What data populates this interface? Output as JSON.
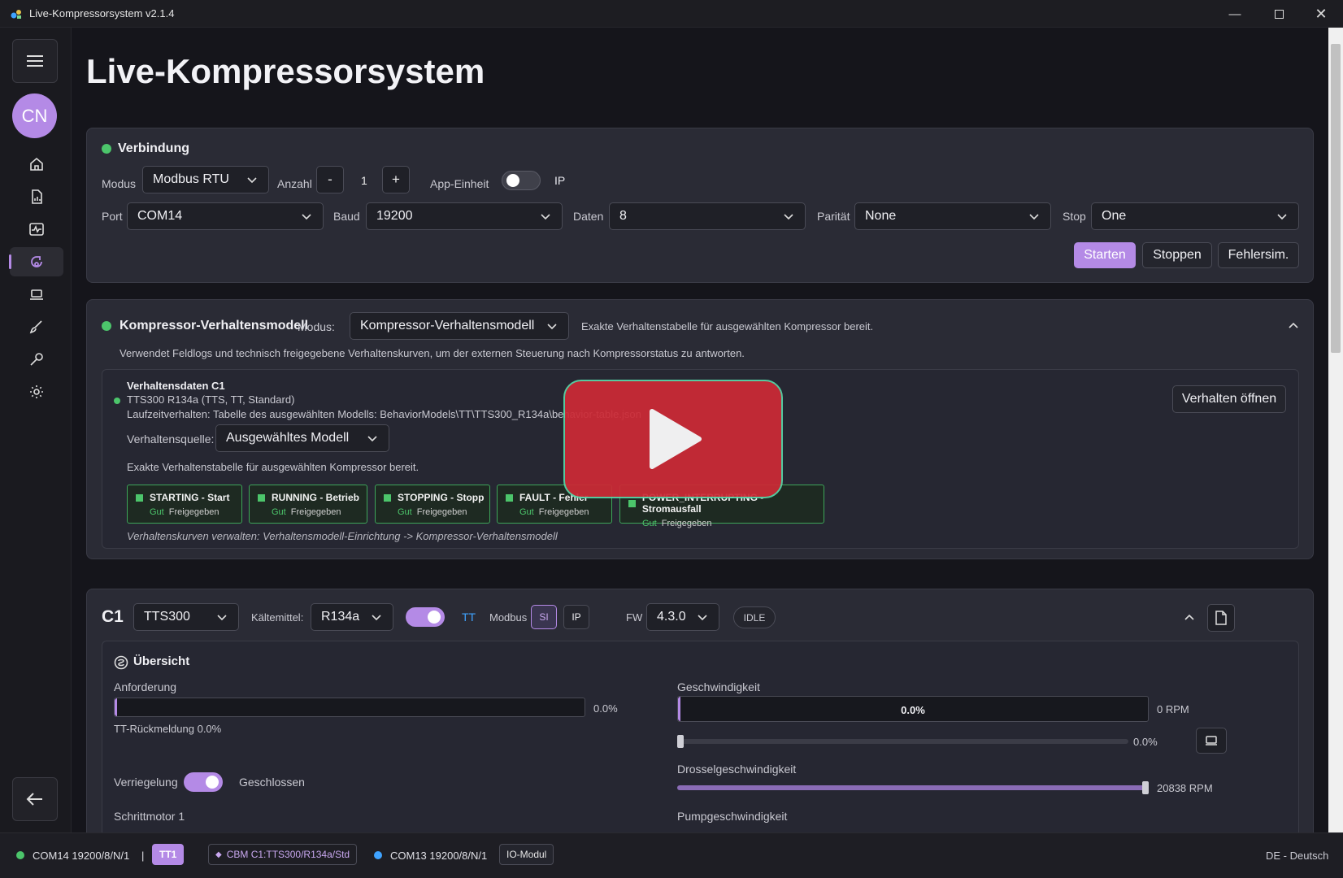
{
  "window": {
    "title": "Live-Kompressorsystem v2.1.4"
  },
  "page": {
    "title": "Live-Kompressorsystem"
  },
  "sidebar": {
    "avatar_initials": "CN"
  },
  "connection": {
    "heading": "Verbindung",
    "mode_label": "Modus",
    "mode_value": "Modbus RTU",
    "count_label": "Anzahl",
    "minus": "-",
    "count_value": "1",
    "plus": "+",
    "app_unit_label": "App-Einheit",
    "ip_label": "IP",
    "port_label": "Port",
    "port_value": "COM14",
    "baud_label": "Baud",
    "baud_value": "19200",
    "data_label": "Daten",
    "data_value": "8",
    "parity_label": "Parität",
    "parity_value": "None",
    "stop_label": "Stop",
    "stop_value": "One",
    "start_btn": "Starten",
    "stop_btn": "Stoppen",
    "faultsim_btn": "Fehlersim."
  },
  "behavior": {
    "heading": "Kompressor-Verhaltensmodell",
    "mode_label": "Modus:",
    "mode_value": "Kompressor-Verhaltensmodell",
    "status_text": "Exakte Verhaltenstabelle für ausgewählten Kompressor bereit.",
    "description": "Verwendet Feldlogs und technisch freigegebene Verhaltenskurven, um der externen Steuerung nach Kompressorstatus zu antworten.",
    "data_title": "Verhaltensdaten C1",
    "model_line": "TTS300 R134a (TTS, TT, Standard)",
    "runtime_line": "Laufzeitverhalten: Tabelle des ausgewählten Modells: BehaviorModels\\TT\\TTS300_R134a\\behavior-table.json",
    "open_btn": "Verhalten öffnen",
    "source_label": "Verhaltensquelle:",
    "source_value": "Ausgewähltes Modell",
    "ready_text": "Exakte Verhaltenstabelle für ausgewählten Kompressor bereit.",
    "states": [
      {
        "title": "STARTING - Start",
        "quality": "Gut",
        "status": "Freigegeben"
      },
      {
        "title": "RUNNING - Betrieb",
        "quality": "Gut",
        "status": "Freigegeben"
      },
      {
        "title": "STOPPING - Stopp",
        "quality": "Gut",
        "status": "Freigegeben"
      },
      {
        "title": "FAULT - Fehler",
        "quality": "Gut",
        "status": "Freigegeben"
      },
      {
        "title": "POWER_INTERRUPTING - Stromausfall",
        "quality": "Gut",
        "status": "Freigegeben"
      }
    ],
    "manage_hint": "Verhaltenskurven verwalten: Verhaltensmodell-Einrichtung -> Kompressor-Verhaltensmodell"
  },
  "compressor": {
    "id": "C1",
    "model_value": "TTS300",
    "refrigerant_label": "Kältemittel:",
    "refrigerant_value": "R134a",
    "tt_label": "TT",
    "modbus_label": "Modbus",
    "si_btn": "SI",
    "ip_btn": "IP",
    "fw_label": "FW",
    "fw_value": "4.3.0",
    "state_badge": "IDLE",
    "overview": {
      "heading": "Übersicht",
      "demand_label": "Anforderung",
      "demand_value": "0.0%",
      "demand_fraction": 0.0,
      "tt_feedback": "TT-Rückmeldung 0.0%",
      "interlock_label": "Verriegelung",
      "interlock_state": "Geschlossen",
      "stepper_label": "Schrittmotor 1",
      "speed_label": "Geschwindigkeit",
      "speed_bar_text": "0.0%",
      "speed_rpm": "0 RPM",
      "speed_slider_value": "0.0%",
      "throttle_label": "Drosselgeschwindigkeit",
      "throttle_rpm": "20838 RPM",
      "throttle_fraction": 1.0,
      "pump_label": "Pumpgeschwindigkeit"
    }
  },
  "statusbar": {
    "port_info": "COM14 19200/8/N/1",
    "sep1": "|",
    "tt_chip": "TT1",
    "cbm_chip": "CBM C1:TTS300/R134a/Std",
    "io_port_info": "COM13 19200/8/N/1",
    "io_chip": "IO-Modul",
    "language": "DE - Deutsch"
  },
  "colors": {
    "accent": "#b48ae6",
    "ok": "#4cc56b",
    "tt_blue": "#3fa3ff",
    "play_red": "#cc2a36"
  }
}
